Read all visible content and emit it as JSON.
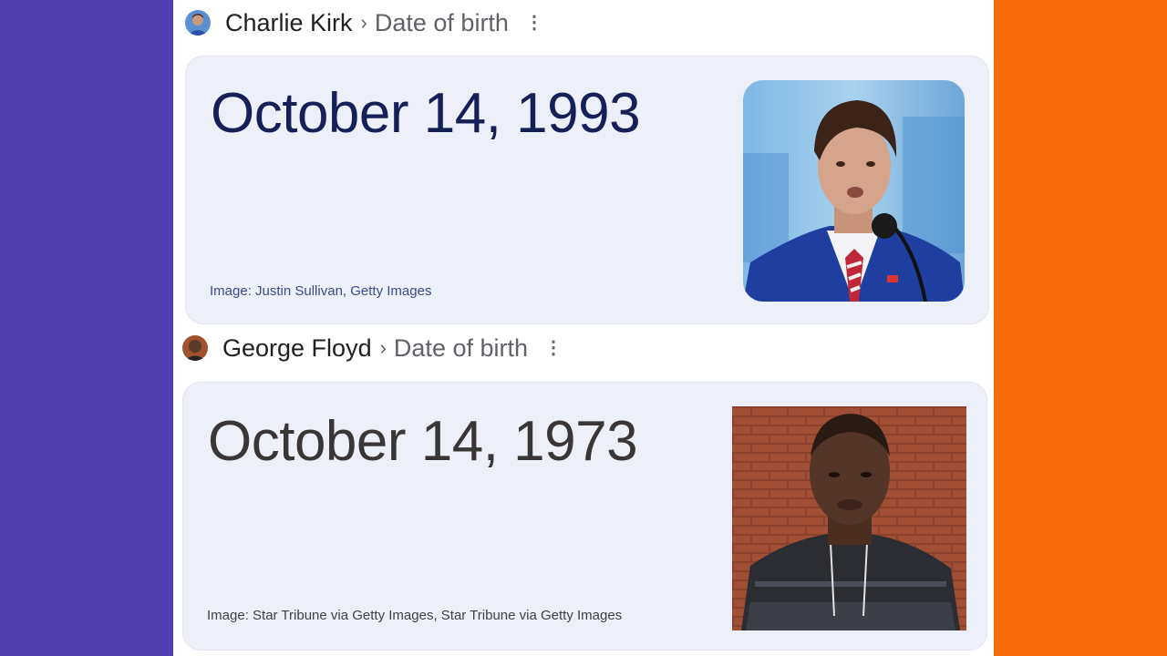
{
  "frame": {
    "left_color": "#5240B2",
    "right_color": "#F66A0A"
  },
  "results": [
    {
      "person": "Charlie Kirk",
      "separator": "›",
      "topic": "Date of birth",
      "more_icon": "more-vert-icon",
      "answer": "October 14, 1993",
      "image_credit": "Image: Justin Sullivan, Getty Images",
      "answer_color": "#142057",
      "credit_color": "#3b4a8c"
    },
    {
      "person": "George Floyd",
      "separator": "›",
      "topic": "Date of birth",
      "more_icon": "more-vert-icon",
      "answer": "October 14, 1973",
      "image_credit": "Image: Star Tribune via Getty Images, Star Tribune via Getty Images",
      "answer_color": "#3a3636",
      "credit_color": "#3f3f46"
    }
  ]
}
